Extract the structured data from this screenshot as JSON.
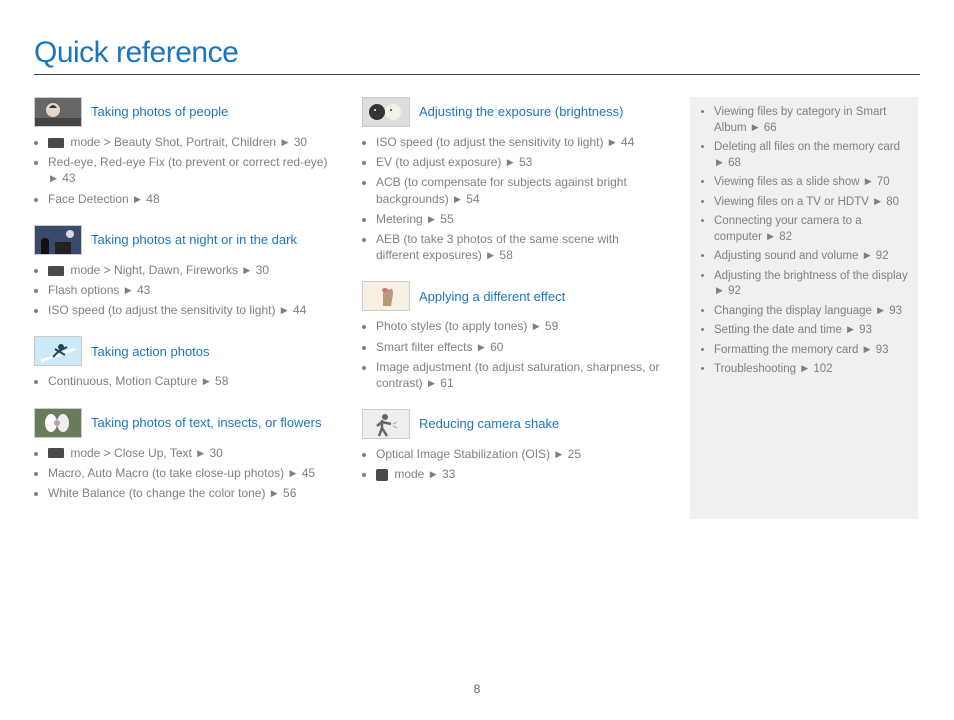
{
  "page": {
    "title": "Quick reference",
    "number": "8"
  },
  "arrow": "▶",
  "col1": [
    {
      "icon": "portrait-icon",
      "title": "Taking photos of people",
      "items": [
        {
          "mode_icon": true,
          "text": " mode > Beauty Shot, Portrait, Children ",
          "page": "30"
        },
        {
          "text": "Red-eye, Red-eye Fix (to prevent or correct red-eye) ",
          "page": "43"
        },
        {
          "text": "Face Detection ",
          "page": "48"
        }
      ]
    },
    {
      "icon": "night-icon",
      "title": "Taking photos at night or in the dark",
      "items": [
        {
          "mode_icon": true,
          "text": " mode > Night, Dawn, Fireworks ",
          "page": "30"
        },
        {
          "text": "Flash options ",
          "page": "43"
        },
        {
          "text": "ISO speed (to adjust the sensitivity to light) ",
          "page": "44"
        }
      ]
    },
    {
      "icon": "action-icon",
      "title": "Taking action photos",
      "items": [
        {
          "text": "Continuous, Motion Capture ",
          "page": "58"
        }
      ]
    },
    {
      "icon": "macro-icon",
      "title": "Taking photos of text, insects, or flowers",
      "items": [
        {
          "mode_icon": true,
          "text": " mode > Close Up, Text ",
          "page": "30"
        },
        {
          "text": "Macro, Auto Macro (to take close-up photos) ",
          "page": "45"
        },
        {
          "text": "White Balance (to change the color tone) ",
          "page": "56"
        }
      ]
    }
  ],
  "col2": [
    {
      "icon": "exposure-icon",
      "title": "Adjusting the exposure (brightness)",
      "items": [
        {
          "text": "ISO speed (to adjust the sensitivity to light) ",
          "page": "44"
        },
        {
          "text": "EV (to adjust exposure) ",
          "page": "53"
        },
        {
          "text": "ACB (to compensate for subjects against bright backgrounds) ",
          "page": "54"
        },
        {
          "text": "Metering ",
          "page": "55"
        },
        {
          "text": "AEB (to take 3 photos of the same scene with different exposures) ",
          "page": "58"
        }
      ]
    },
    {
      "icon": "effect-icon",
      "title": "Applying a different effect",
      "items": [
        {
          "text": "Photo styles (to apply tones) ",
          "page": "59"
        },
        {
          "text": "Smart filter effects ",
          "page": "60"
        },
        {
          "text": "Image adjustment (to adjust saturation, sharpness, or contrast) ",
          "page": "61"
        }
      ]
    },
    {
      "icon": "shake-icon",
      "title": "Reducing camera shake",
      "items": [
        {
          "text": "Optical Image Stabilization (OIS) ",
          "page": "25"
        },
        {
          "hand_icon": true,
          "text": " mode ",
          "page": "33"
        }
      ]
    }
  ],
  "side": [
    {
      "text": "Viewing files by category in Smart Album ",
      "page": "66"
    },
    {
      "text": "Deleting all files on the memory card ",
      "page": "68"
    },
    {
      "text": "Viewing files as a slide show ",
      "page": "70"
    },
    {
      "text": "Viewing files on a TV or HDTV ",
      "page": "80"
    },
    {
      "text": "Connecting your camera to a computer ",
      "page": "82"
    },
    {
      "text": "Adjusting sound and volume ",
      "page": "92"
    },
    {
      "text": "Adjusting the brightness of the display ",
      "page": "92"
    },
    {
      "text": "Changing the display language ",
      "page": "93"
    },
    {
      "text": "Setting the date and time ",
      "page": "93"
    },
    {
      "text": "Formatting the memory card ",
      "page": "93"
    },
    {
      "text": "Troubleshooting ",
      "page": "102"
    }
  ]
}
